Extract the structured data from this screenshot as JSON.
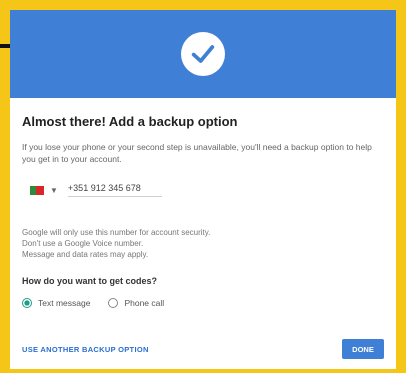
{
  "page": {
    "title": "Almost there! Add a backup option",
    "description": "If you lose your phone or your second step is unavailable, you'll need a backup option to help you get in to your account."
  },
  "phone": {
    "country_flag": "portugal-flag",
    "number": "+351 912 345 678"
  },
  "notes": [
    "Google will only use this number for account security.",
    "Don't use a Google Voice number.",
    "Message and data rates may apply."
  ],
  "codes": {
    "question": "How do you want to get codes?",
    "options": [
      {
        "label": "Text message",
        "selected": true
      },
      {
        "label": "Phone call",
        "selected": false
      }
    ]
  },
  "actions": {
    "secondary_label": "USE ANOTHER BACKUP OPTION",
    "primary_label": "DONE"
  },
  "colors": {
    "page_bg": "#f5c518",
    "header_blue": "#3f7fd6",
    "radio_accent": "#1e9e8a",
    "link_blue": "#2a6ed0"
  }
}
